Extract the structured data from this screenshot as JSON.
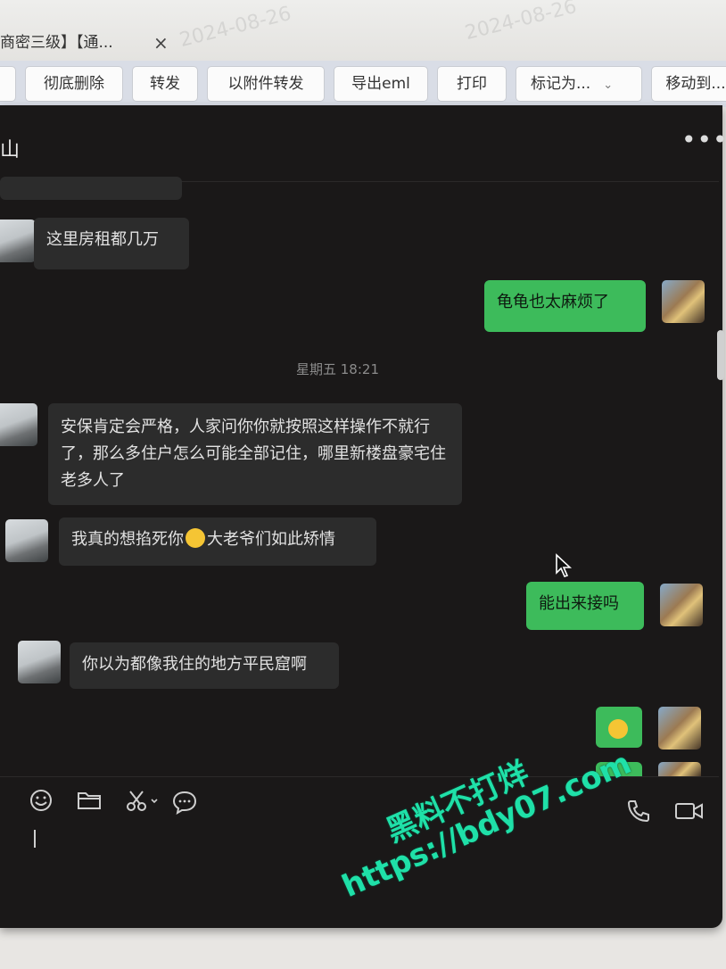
{
  "browser": {
    "tab_title": "商密三级】【通...",
    "close_glyph": "×",
    "faint_watermark": "2024-08-26"
  },
  "toolbar": {
    "buttons": [
      "彻底删除",
      "转发",
      "以附件转发",
      "导出eml",
      "打印",
      "标记为...",
      "移动到..."
    ]
  },
  "chat": {
    "title": "山",
    "more_glyph": "•••",
    "timestamp": "星期五 18:21",
    "messages": [
      {
        "side": "left",
        "text": "这里房租都几万"
      },
      {
        "side": "right",
        "text": "龟龟也太麻烦了"
      },
      {
        "side": "left",
        "text": "安保肯定会严格，人家问你你就按照这样操作不就行了，那么多住户怎么可能全部记住，哪里新楼盘豪宅住老多人了"
      },
      {
        "side": "left",
        "text_before": "我真的想掐死你",
        "emoji": "face-with-hand-over-mouth",
        "text_after": "大老爷们如此矫情"
      },
      {
        "side": "right",
        "text": "能出来接吗"
      },
      {
        "side": "left",
        "text": "你以为都像我住的地方平民窟啊"
      },
      {
        "side": "right",
        "emoji": "flushed-face"
      }
    ]
  },
  "composer": {
    "icons": [
      "emoji-icon",
      "folder-icon",
      "scissors-icon",
      "chat-icon",
      "phone-icon",
      "video-icon"
    ]
  },
  "promo_watermark": {
    "line1": "黑料不打烊",
    "line2": "https://bdy07.com"
  },
  "colors": {
    "my_bubble": "#3dbb5b",
    "their_bubble": "#2c2c2c",
    "window_bg": "#1a1818",
    "promo_text": "#1fe0a8"
  }
}
